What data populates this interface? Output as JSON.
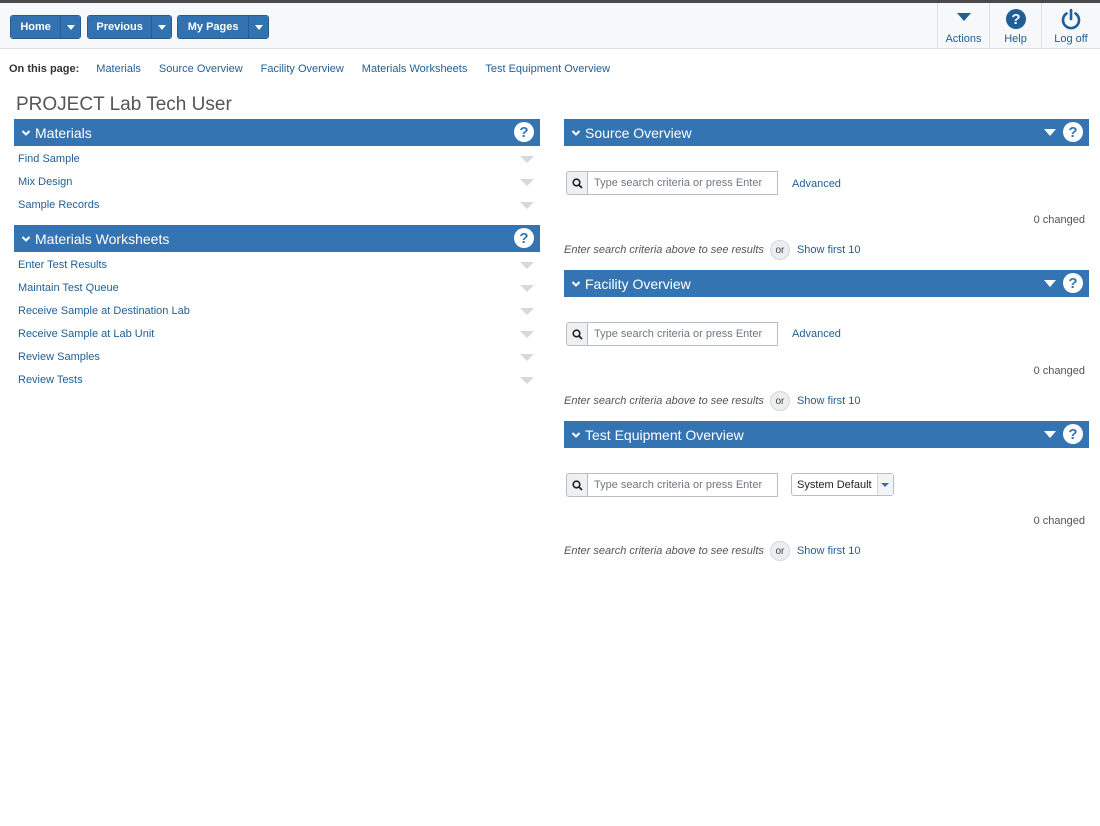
{
  "nav": {
    "home": "Home",
    "previous": "Previous",
    "my_pages": "My Pages"
  },
  "tools": {
    "actions": "Actions",
    "help": "Help",
    "logoff": "Log off"
  },
  "on_this_page": {
    "caption": "On this page:",
    "links": [
      "Materials",
      "Source Overview",
      "Facility Overview",
      "Materials Worksheets",
      "Test Equipment Overview"
    ]
  },
  "page_title": "PROJECT Lab Tech User",
  "materials": {
    "title": "Materials",
    "items": [
      "Find Sample",
      "Mix Design",
      "Sample Records"
    ]
  },
  "worksheets": {
    "title": "Materials Worksheets",
    "items": [
      "Enter Test Results",
      "Maintain Test Queue",
      "Receive Sample at Destination Lab",
      "Receive Sample at Lab Unit",
      "Review Samples",
      "Review Tests"
    ]
  },
  "source": {
    "title": "Source Overview",
    "placeholder": "Type search criteria or press Enter",
    "advanced": "Advanced",
    "changed": "0 changed",
    "hint": "Enter search criteria above to see results",
    "or": "or",
    "show_first": "Show first 10"
  },
  "facility": {
    "title": "Facility Overview",
    "placeholder": "Type search criteria or press Enter",
    "advanced": "Advanced",
    "changed": "0 changed",
    "hint": "Enter search criteria above to see results",
    "or": "or",
    "show_first": "Show first 10"
  },
  "equipment": {
    "title": "Test Equipment Overview",
    "placeholder": "Type search criteria or press Enter",
    "select_value": "System Default",
    "changed": "0 changed",
    "hint": "Enter search criteria above to see results",
    "or": "or",
    "show_first": "Show first 10"
  },
  "colors": {
    "accent": "#3574b2",
    "link": "#1f5f96"
  }
}
